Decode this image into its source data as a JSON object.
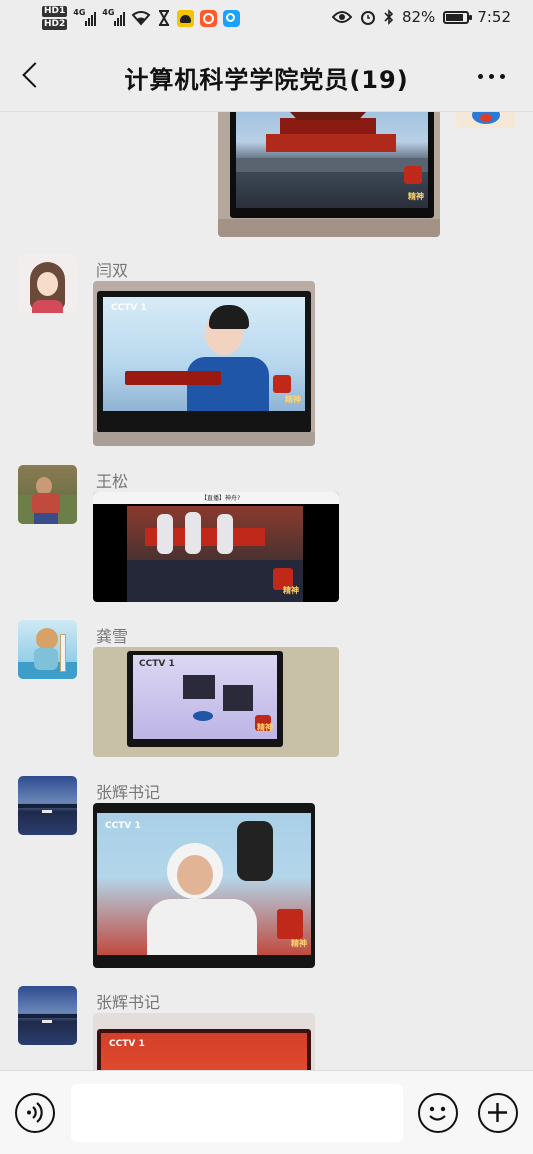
{
  "status_bar": {
    "hd1": "HD1",
    "hd2": "HD2",
    "net1": "4G",
    "net2": "4G",
    "battery_percent": "82%",
    "battery_level": 0.82,
    "time": "7:52",
    "icons": [
      "wifi-icon",
      "hourglass-icon",
      "notification-app-icon",
      "app-icon-orange",
      "app-icon-blue",
      "eye-icon",
      "bluetooth-icon",
      "alarm-icon",
      "battery-icon"
    ]
  },
  "header": {
    "title": "计算机科学学院党员(19)"
  },
  "messages": [
    {
      "sender": "闫双"
    },
    {
      "sender": "王松"
    },
    {
      "sender": "龚雪"
    },
    {
      "sender": "张辉书记"
    },
    {
      "sender": "张辉书记"
    }
  ],
  "photos": {
    "tv_watermark": "精神",
    "cctv_logo": "CCTV 1",
    "phone_header": "【直播】神舟?"
  },
  "composer": {
    "placeholder": ""
  },
  "colors": {
    "background": "#ededed",
    "bottom_bar": "#f7f7f7",
    "bubble_white": "#ffffff"
  }
}
